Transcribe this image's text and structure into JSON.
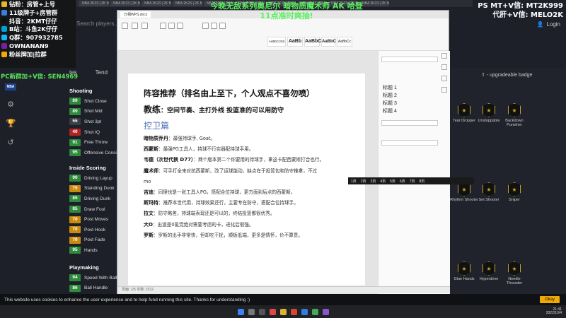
{
  "background_app": {
    "tabs": [
      "NBA 2K23 | 2K M",
      "NBA 2K23 | 2K M",
      "NBA 2K23 | 2K M",
      "NBA 2K23 | 2K M",
      "NBA 2K23 | 2K M",
      "NBA 2K23 | 2K M",
      "NBA 2K23 | 2K M",
      "NBA 2K23 | 2K M",
      "NBA 2K23 | 2K M",
      "NBA 2K23 | 2K M"
    ],
    "search_placeholder": "Search players...",
    "login_label": "Login",
    "nav_tabs": [
      "tes",
      "Tend"
    ],
    "groups": [
      {
        "title": "Shooting",
        "items": [
          {
            "value": "89",
            "name": "Shot Close",
            "color": "#2e8b3c"
          },
          {
            "value": "89",
            "name": "Shot Mid",
            "color": "#2e8b3c"
          },
          {
            "value": "55",
            "name": "Shot 3pt",
            "color": "#3a3d45"
          },
          {
            "value": "40",
            "name": "Shot IQ",
            "color": "#b22222"
          },
          {
            "value": "91",
            "name": "Free Throw",
            "color": "#2e8b3c"
          },
          {
            "value": "95",
            "name": "Offensive Consi",
            "color": "#2e8b3c"
          }
        ]
      },
      {
        "title": "Inside Scoring",
        "items": [
          {
            "value": "90",
            "name": "Driving Layup",
            "color": "#2e8b3c"
          },
          {
            "value": "75",
            "name": "Standing Dunk",
            "color": "#c98a0e"
          },
          {
            "value": "85",
            "name": "Driving Dunk",
            "color": "#2e8b3c"
          },
          {
            "value": "85",
            "name": "Draw Foul",
            "color": "#2e8b3c"
          },
          {
            "value": "70",
            "name": "Post Moves",
            "color": "#c98a0e"
          },
          {
            "value": "70",
            "name": "Post Hook",
            "color": "#c98a0e"
          },
          {
            "value": "70",
            "name": "Post Fade",
            "color": "#c98a0e"
          },
          {
            "value": "95",
            "name": "Hands",
            "color": "#2e8b3c"
          }
        ]
      },
      {
        "title": "Playmaking",
        "items": [
          {
            "value": "94",
            "name": "Speed With Ball",
            "color": "#2e8b3c"
          },
          {
            "value": "86",
            "name": "Ball Handle",
            "color": "#2e8b3c"
          }
        ]
      }
    ],
    "badge_header": "⇧ - upgradeable badge",
    "badges": [
      {
        "name": "Tear Dropper"
      },
      {
        "name": "Unstoppable"
      },
      {
        "name": "Backdown Punisher"
      },
      {
        "name": "Rhythm Shooter"
      },
      {
        "name": "Set Shooter"
      },
      {
        "name": "Sniper"
      },
      {
        "name": "Glue Hands"
      },
      {
        "name": "Hyperdrive"
      },
      {
        "name": "Needle Threader"
      }
    ]
  },
  "document": {
    "tab_label": "万相WPS.docx",
    "styles": [
      "AaBbCcDd",
      "AaBb",
      "AaBbC",
      "AaBbC",
      "AaBbCc"
    ],
    "title": "阵容推荐（排名由上至下，个人观点不喜勿喷）",
    "coach_label": "教练",
    "coach_text": "：空间节奏、主打外线 投篮准的可以用防守",
    "section": "控卫篇",
    "lines": [
      {
        "name": "暗物质乔丹",
        "text": "：最强持球手, Goat。"
      },
      {
        "name": "西蒙斯",
        "text": "：最强PG工具人，持球不行实器配持球手用。"
      },
      {
        "name": "韦德（次世代换 D77）",
        "text": "：两个版本第二个你要用的持球手，拿这卡配西蒙斯打合也行。"
      },
      {
        "name": "魔术师",
        "text": "：可手打全来对抗西蒙斯，改了运球能动，缺点在于投篮包和防守推拿，不过"
      },
      {
        "name": "",
        "text": "mo"
      },
      {
        "name": "吉迪",
        "text": "：同理也是一张工具人PG，搭配合位持球，更方面到后点的西蒙斯。"
      },
      {
        "name": "斯玛特",
        "text": "：推荐本世代用，持球效果还行，主要专在防守，搭配合位持球手。"
      },
      {
        "name": "拉文",
        "text": "：防守略差，持球端表现还是可以的，终结投篮都很优秀。"
      },
      {
        "name": "大O",
        "text": "：出道是0氪党绝对需要考虑的卡，进化后很强。"
      },
      {
        "name": "罗斯",
        "text": "：罗斯的出手非常快，但却吃干扰，顺板低端，更多是情怀，价不算贵。"
      }
    ],
    "side_panel": {
      "headings": [
        "标题 1",
        "标题 2",
        "标题 3",
        "标题 4"
      ]
    },
    "status_text": "页面: 1/5  字数: 2312"
  },
  "float_toolbar": {
    "items": [
      "1页",
      "2页",
      "3页",
      "4页",
      "5页",
      "6页",
      "7页",
      "8页"
    ]
  },
  "overlay": {
    "stream_lines": [
      {
        "icon_color": "#e8b923",
        "text": "钻粉：房管+上号"
      },
      {
        "icon_color": "#3b7ddd",
        "text": "11级牌子+房管群"
      },
      {
        "icon_color": "#111111",
        "text": "抖音：2KMT仔仔"
      },
      {
        "icon_color": "#00a1d6",
        "text": "B站：斗鱼2K仔仔"
      },
      {
        "icon_color": "#12b7f5",
        "text": "Q群：907932785"
      },
      {
        "icon_color": "#7b1fa2",
        "text": "OWNANAN9"
      },
      {
        "icon_color": "#f2a900",
        "text": "粉丝牌加|拉群"
      }
    ],
    "pc_group": "PC新群加+V信: SEN4969",
    "banner_1": "今晚无敌系列奥尼尔 暗物质魔术师 AK 哈登",
    "banner_2": "11点准时爽抽!",
    "top_right_1": "PS MT+V信: MT2K999",
    "top_right_2": "代肝+V信: MELO2K"
  },
  "cookie": {
    "text": "This website uses cookies to enhance the user experience and to help fund running this site. Thanks for understanding :)",
    "ok_label": "Okay"
  },
  "taskbar": {
    "time": "21:41",
    "date": "2022/10/4"
  }
}
